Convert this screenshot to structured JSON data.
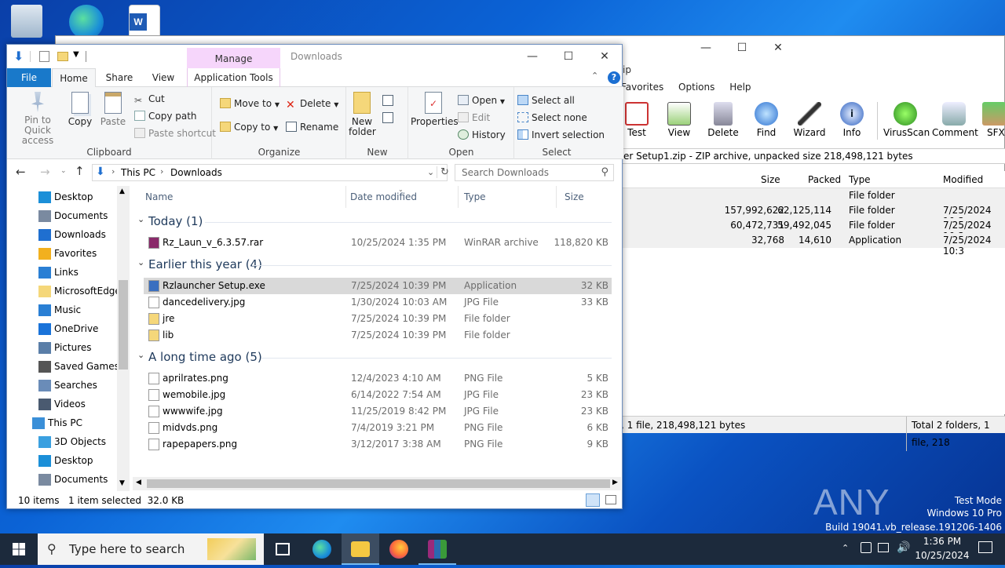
{
  "desktop": {
    "icons": [
      "recycle-bin-icon",
      "edge-icon",
      "word-icon"
    ]
  },
  "winrar": {
    "menu": [
      "Favorites",
      "Options",
      "Help"
    ],
    "title_fragment": "ip",
    "tools": [
      {
        "label": "Test",
        "icon": "test-icon"
      },
      {
        "label": "View",
        "icon": "view-icon"
      },
      {
        "label": "Delete",
        "icon": "delete-icon"
      },
      {
        "label": "Find",
        "icon": "find-icon"
      },
      {
        "label": "Wizard",
        "icon": "wizard-icon"
      },
      {
        "label": "Info",
        "icon": "info-icon"
      },
      {
        "label": "VirusScan",
        "icon": "virusscan-icon"
      },
      {
        "label": "Comment",
        "icon": "comment-icon"
      },
      {
        "label": "SFX",
        "icon": "sfx-icon"
      }
    ],
    "path_text": "er Setup1.zip - ZIP archive, unpacked size 218,498,121 bytes",
    "columns": {
      "size": "Size",
      "packed": "Packed",
      "type": "Type",
      "modified": "Modified"
    },
    "rows": [
      {
        "size": "",
        "packed": "",
        "type": "File folder",
        "modified": ""
      },
      {
        "size": "157,992,622",
        "packed": "62,125,114",
        "type": "File folder",
        "modified": "7/25/2024 10:3"
      },
      {
        "size": "60,472,731",
        "packed": "59,492,045",
        "type": "File folder",
        "modified": "7/25/2024 10:3"
      },
      {
        "size": "32,768",
        "packed": "14,610",
        "type": "Application",
        "modified": "7/25/2024 10:3"
      }
    ],
    "status_left": ", 1 file, 218,498,121 bytes",
    "status_right": "Total 2 folders, 1 file, 218"
  },
  "explorer": {
    "title": "Downloads",
    "context_tab": "Manage",
    "tabs": [
      "File",
      "Home",
      "Share",
      "View",
      "Application Tools"
    ],
    "ribbon": {
      "clipboard": {
        "label": "Clipboard",
        "pin": "Pin to Quick access",
        "copy": "Copy",
        "paste": "Paste",
        "cut": "Cut",
        "copy_path": "Copy path",
        "paste_shortcut": "Paste shortcut"
      },
      "organize": {
        "label": "Organize",
        "move_to": "Move to",
        "copy_to": "Copy to",
        "delete": "Delete",
        "rename": "Rename"
      },
      "new": {
        "label": "New",
        "new_folder": "New folder"
      },
      "open": {
        "label": "Open",
        "properties": "Properties",
        "open": "Open",
        "edit": "Edit",
        "history": "History"
      },
      "select": {
        "label": "Select",
        "select_all": "Select all",
        "select_none": "Select none",
        "invert": "Invert selection"
      }
    },
    "address": {
      "root": "This PC",
      "current": "Downloads"
    },
    "search_placeholder": "Search Downloads",
    "nav": [
      {
        "label": "Desktop",
        "icon": "desktop-icon",
        "color": "#1b8fd8",
        "level": 1
      },
      {
        "label": "Documents",
        "icon": "documents-icon",
        "color": "#7a8aa0",
        "level": 1
      },
      {
        "label": "Downloads",
        "icon": "downloads-icon",
        "color": "#1f6fd0",
        "level": 1
      },
      {
        "label": "Favorites",
        "icon": "star-icon",
        "color": "#f2b01e",
        "level": 1
      },
      {
        "label": "Links",
        "icon": "links-icon",
        "color": "#2a7fd4",
        "level": 1
      },
      {
        "label": "MicrosoftEdge",
        "icon": "folder-icon",
        "color": "#f5d77a",
        "level": 1
      },
      {
        "label": "Music",
        "icon": "music-icon",
        "color": "#2a7fd4",
        "level": 1
      },
      {
        "label": "OneDrive",
        "icon": "onedrive-icon",
        "color": "#1a73d9",
        "level": 1
      },
      {
        "label": "Pictures",
        "icon": "pictures-icon",
        "color": "#5a7ea8",
        "level": 1
      },
      {
        "label": "Saved Games",
        "icon": "saved-games-icon",
        "color": "#555",
        "level": 1
      },
      {
        "label": "Searches",
        "icon": "searches-icon",
        "color": "#6a8cb8",
        "level": 1
      },
      {
        "label": "Videos",
        "icon": "videos-icon",
        "color": "#4a5a70",
        "level": 1
      },
      {
        "label": "This PC",
        "icon": "this-pc-icon",
        "color": "#3a8fd8",
        "level": 0
      },
      {
        "label": "3D Objects",
        "icon": "3d-objects-icon",
        "color": "#3aa0e0",
        "level": 1
      },
      {
        "label": "Desktop",
        "icon": "desktop-icon",
        "color": "#1b8fd8",
        "level": 1
      },
      {
        "label": "Documents",
        "icon": "documents-icon",
        "color": "#7a8aa0",
        "level": 1
      }
    ],
    "columns": {
      "name": "Name",
      "date": "Date modified",
      "type": "Type",
      "size": "Size"
    },
    "groups": [
      {
        "title": "Today (1)",
        "files": [
          {
            "name": "Rz_Laun_v_6.3.57.rar",
            "date": "10/25/2024 1:35 PM",
            "type": "WinRAR archive",
            "size": "118,820 KB",
            "icon": "rar-icon",
            "color": "#8a2a6a",
            "selected": false
          }
        ]
      },
      {
        "title": "Earlier this year (4)",
        "files": [
          {
            "name": "Rzlauncher Setup.exe",
            "date": "7/25/2024 10:39 PM",
            "type": "Application",
            "size": "32 KB",
            "icon": "exe-icon",
            "color": "#3a6fc0",
            "selected": true
          },
          {
            "name": "dancedelivery.jpg",
            "date": "1/30/2024 10:03 AM",
            "type": "JPG File",
            "size": "33 KB",
            "icon": "file-icon",
            "color": "#ffffff",
            "selected": false
          },
          {
            "name": "jre",
            "date": "7/25/2024 10:39 PM",
            "type": "File folder",
            "size": "",
            "icon": "folder-icon",
            "color": "#f5d77a",
            "selected": false
          },
          {
            "name": "lib",
            "date": "7/25/2024 10:39 PM",
            "type": "File folder",
            "size": "",
            "icon": "folder-icon",
            "color": "#f5d77a",
            "selected": false
          }
        ]
      },
      {
        "title": "A long time ago (5)",
        "files": [
          {
            "name": "aprilrates.png",
            "date": "12/4/2023 4:10 AM",
            "type": "PNG File",
            "size": "5 KB",
            "icon": "file-icon",
            "color": "#ffffff",
            "selected": false
          },
          {
            "name": "wemobile.jpg",
            "date": "6/14/2022 7:54 AM",
            "type": "JPG File",
            "size": "23 KB",
            "icon": "file-icon",
            "color": "#ffffff",
            "selected": false
          },
          {
            "name": "wwwwife.jpg",
            "date": "11/25/2019 8:42 PM",
            "type": "JPG File",
            "size": "23 KB",
            "icon": "file-icon",
            "color": "#ffffff",
            "selected": false
          },
          {
            "name": "midvds.png",
            "date": "7/4/2019 3:21 PM",
            "type": "PNG File",
            "size": "6 KB",
            "icon": "file-icon",
            "color": "#ffffff",
            "selected": false
          },
          {
            "name": "rapepapers.png",
            "date": "3/12/2017 3:38 AM",
            "type": "PNG File",
            "size": "9 KB",
            "icon": "file-icon",
            "color": "#ffffff",
            "selected": false
          }
        ]
      }
    ],
    "status": {
      "count": "10 items",
      "selection": "1 item selected  32.0 KB"
    }
  },
  "taskbar": {
    "search_placeholder": "Type here to search",
    "apps": [
      "task-view-icon",
      "edge-icon",
      "file-explorer-icon",
      "firefox-icon",
      "winrar-icon"
    ],
    "time": "1:36 PM",
    "date": "10/25/2024"
  },
  "watermark": {
    "brand": "ANY RUN",
    "mode": "Test Mode",
    "os": "Windows 10 Pro",
    "build": "Build 19041.vb_release.191206-1406"
  }
}
